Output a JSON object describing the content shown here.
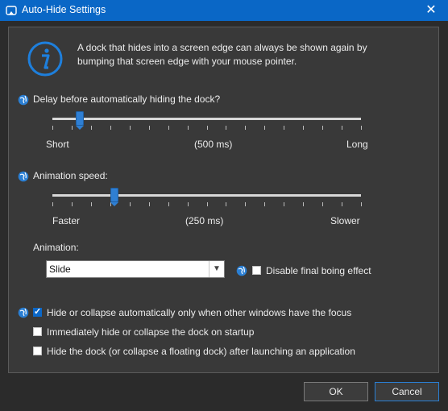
{
  "window": {
    "title": "Auto-Hide Settings",
    "close_glyph": "✕"
  },
  "info": {
    "icon": "info-icon",
    "text": "A dock that hides into a screen edge can always be shown again by bumping that screen edge with your mouse pointer."
  },
  "delay": {
    "label": "Delay before automatically hiding the dock?",
    "min_label": "Short",
    "value_label": "(500 ms)",
    "max_label": "Long",
    "value_fraction": 0.09
  },
  "speed": {
    "label": "Animation speed:",
    "min_label": "Faster",
    "value_label": "(250 ms)",
    "max_label": "Slower",
    "value_fraction": 0.2
  },
  "animation": {
    "label": "Animation:",
    "selected": "Slide",
    "disable_boing_label": "Disable final boing effect",
    "disable_boing_checked": false
  },
  "options": [
    {
      "label": "Hide or collapse automatically only when other windows have the focus",
      "checked": true
    },
    {
      "label": "Immediately hide or collapse the dock on startup",
      "checked": false
    },
    {
      "label": "Hide the dock (or collapse a floating dock) after launching an application",
      "checked": false
    }
  ],
  "buttons": {
    "ok": "OK",
    "cancel": "Cancel"
  },
  "colors": {
    "titlebar": "#0a67c6",
    "accent": "#2f7fd3",
    "panel": "#393939",
    "background": "#2b2b2b"
  }
}
